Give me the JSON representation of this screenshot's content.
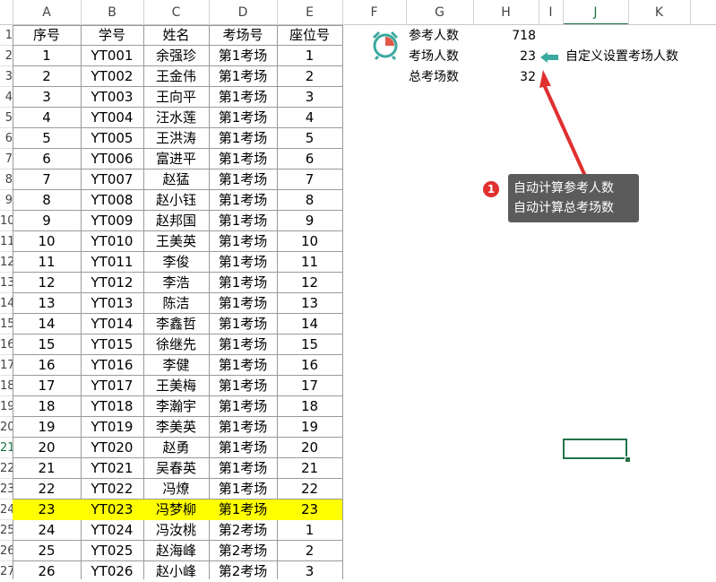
{
  "columns": [
    "A",
    "B",
    "C",
    "D",
    "E",
    "F",
    "G",
    "H",
    "I",
    "J",
    "K"
  ],
  "row_numbers": [
    "1",
    "2",
    "3",
    "4",
    "5",
    "6",
    "7",
    "8",
    "9",
    "10",
    "11",
    "12",
    "13",
    "14",
    "15",
    "16",
    "17",
    "18",
    "19",
    "20",
    "21",
    "22",
    "23",
    "24",
    "25",
    "26",
    "27"
  ],
  "table": {
    "headers": [
      "序号",
      "学号",
      "姓名",
      "考场号",
      "座位号"
    ],
    "rows": [
      [
        "1",
        "YT001",
        "余强珍",
        "第1考场",
        "1"
      ],
      [
        "2",
        "YT002",
        "王金伟",
        "第1考场",
        "2"
      ],
      [
        "3",
        "YT003",
        "王向平",
        "第1考场",
        "3"
      ],
      [
        "4",
        "YT004",
        "汪水莲",
        "第1考场",
        "4"
      ],
      [
        "5",
        "YT005",
        "王洪涛",
        "第1考场",
        "5"
      ],
      [
        "6",
        "YT006",
        "富进平",
        "第1考场",
        "6"
      ],
      [
        "7",
        "YT007",
        "赵猛",
        "第1考场",
        "7"
      ],
      [
        "8",
        "YT008",
        "赵小钰",
        "第1考场",
        "8"
      ],
      [
        "9",
        "YT009",
        "赵邦国",
        "第1考场",
        "9"
      ],
      [
        "10",
        "YT010",
        "王美英",
        "第1考场",
        "10"
      ],
      [
        "11",
        "YT011",
        "李俊",
        "第1考场",
        "11"
      ],
      [
        "12",
        "YT012",
        "李浩",
        "第1考场",
        "12"
      ],
      [
        "13",
        "YT013",
        "陈洁",
        "第1考场",
        "13"
      ],
      [
        "14",
        "YT014",
        "李鑫哲",
        "第1考场",
        "14"
      ],
      [
        "15",
        "YT015",
        "徐继先",
        "第1考场",
        "15"
      ],
      [
        "16",
        "YT016",
        "李健",
        "第1考场",
        "16"
      ],
      [
        "17",
        "YT017",
        "王美梅",
        "第1考场",
        "17"
      ],
      [
        "18",
        "YT018",
        "李瀚宇",
        "第1考场",
        "18"
      ],
      [
        "19",
        "YT019",
        "李美英",
        "第1考场",
        "19"
      ],
      [
        "20",
        "YT020",
        "赵勇",
        "第1考场",
        "20"
      ],
      [
        "21",
        "YT021",
        "吴春英",
        "第1考场",
        "21"
      ],
      [
        "22",
        "YT022",
        "冯燎",
        "第1考场",
        "22"
      ],
      [
        "23",
        "YT023",
        "冯梦柳",
        "第1考场",
        "23"
      ],
      [
        "24",
        "YT024",
        "冯汝桃",
        "第2考场",
        "1"
      ],
      [
        "25",
        "YT025",
        "赵海峰",
        "第2考场",
        "2"
      ],
      [
        "26",
        "YT026",
        "赵小峰",
        "第2考场",
        "3"
      ]
    ],
    "highlight_row_index": 22,
    "highlight_color": "#ffff00"
  },
  "info": {
    "total_label": "参考人数",
    "total_value": "718",
    "per_room_label": "考场人数",
    "per_room_value": "23",
    "rooms_label": "总考场数",
    "rooms_value": "32",
    "per_room_note": "自定义设置考场人数"
  },
  "callout": {
    "badge": "1",
    "line1": "自动计算参考人数",
    "line2": "自动计算总考场数"
  },
  "icons": {
    "clock": "alarm-clock-icon",
    "arrow": "left-arrow-icon"
  },
  "colors": {
    "accent": "#217346",
    "callout_bg": "#5b5b5b",
    "arrow_red": "#e03030",
    "clock_teal": "#3aa99f",
    "clock_red": "#e05a4a",
    "note_arrow": "#3aa99f"
  },
  "selected_cell": "J21"
}
